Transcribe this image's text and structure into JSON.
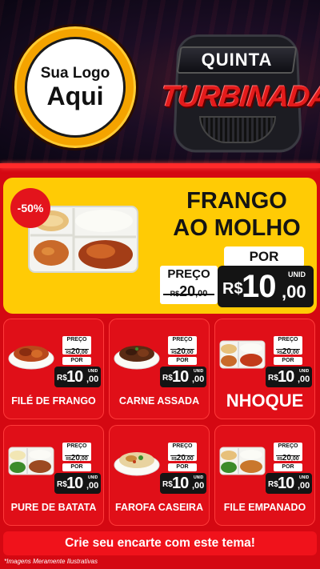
{
  "logo": {
    "line1": "Sua Logo",
    "line2": "Aqui"
  },
  "badge": {
    "line1": "QUINTA",
    "line2": "TURBINADA"
  },
  "featured": {
    "discount": "-50%",
    "title_line1": "FRANGO",
    "title_line2": "AO MOLHO",
    "preco_label": "PREÇO",
    "por_label": "POR",
    "old_price": {
      "currency": "R$",
      "int": "20",
      "dec": ",00"
    },
    "new_price": {
      "currency": "R$",
      "int": "10",
      "dec": ",00",
      "unit": "UNID"
    }
  },
  "items": [
    {
      "name": "FILÉ DE FRANGO",
      "preco_label": "PREÇO",
      "por_label": "POR",
      "old_currency": "R$",
      "old_int": "20",
      "old_dec": ",00",
      "new_currency": "R$",
      "new_int": "10",
      "new_dec": ",00",
      "unit": "UNID"
    },
    {
      "name": "CARNE ASSADA",
      "preco_label": "PREÇO",
      "por_label": "POR",
      "old_currency": "R$",
      "old_int": "20",
      "old_dec": ",00",
      "new_currency": "R$",
      "new_int": "10",
      "new_dec": ",00",
      "unit": "UNID"
    },
    {
      "name": "NHOQUE",
      "preco_label": "PREÇO",
      "por_label": "POR",
      "old_currency": "R$",
      "old_int": "20",
      "old_dec": ",00",
      "new_currency": "R$",
      "new_int": "10",
      "new_dec": ",00",
      "unit": "UNID"
    },
    {
      "name": "PURE DE BATATA",
      "preco_label": "PREÇO",
      "por_label": "POR",
      "old_currency": "R$",
      "old_int": "20",
      "old_dec": ",00",
      "new_currency": "R$",
      "new_int": "10",
      "new_dec": ",00",
      "unit": "UNID"
    },
    {
      "name": "FAROFA CASEIRA",
      "preco_label": "PREÇO",
      "por_label": "POR",
      "old_currency": "R$",
      "old_int": "20",
      "old_dec": ",00",
      "new_currency": "R$",
      "new_int": "10",
      "new_dec": ",00",
      "unit": "UNID"
    },
    {
      "name": "FILE EMPANADO",
      "preco_label": "PREÇO",
      "por_label": "POR",
      "old_currency": "R$",
      "old_int": "20",
      "old_dec": ",00",
      "new_currency": "R$",
      "new_int": "10",
      "new_dec": ",00",
      "unit": "UNID"
    }
  ],
  "cta": "Crie seu encarte com este tema!",
  "disclaimer": "*Imagens Meramente Ilustrativas",
  "colors": {
    "red": "#e00f18",
    "yellow": "#ffcb05",
    "dark": "#141414",
    "white": "#ffffff"
  },
  "icons": {
    "featured_photo": "marmita-frango-icon",
    "card_photos": [
      "file-frango-bowl-icon",
      "carne-assada-bowl-icon",
      "nhoque-marmita-icon",
      "pure-batata-marmita-icon",
      "farofa-bowl-icon",
      "file-empanado-marmita-icon"
    ]
  }
}
